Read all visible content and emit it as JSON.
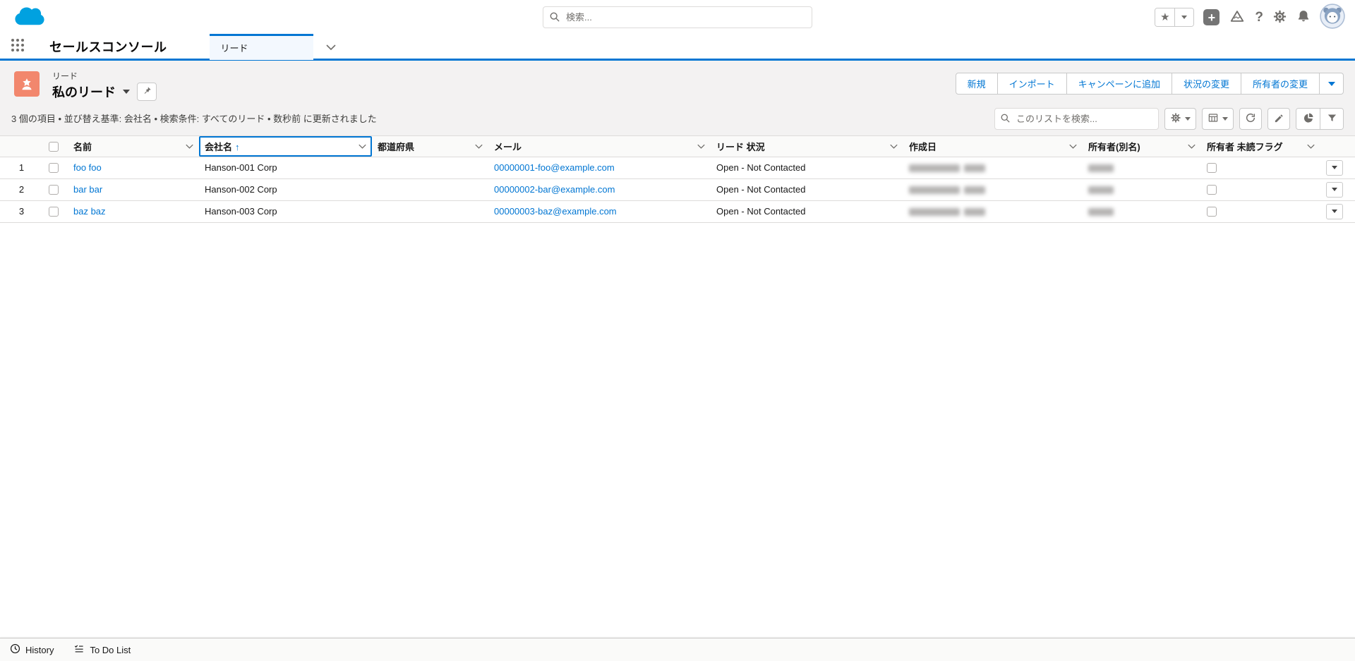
{
  "global_header": {
    "search_placeholder": "検索...",
    "icons": [
      "favorites-star",
      "favorites-caret",
      "global-actions-plus",
      "guidance-center",
      "help",
      "setup-gear",
      "notifications-bell",
      "user-avatar"
    ]
  },
  "nav": {
    "app_name": "セールスコンソール",
    "tab_label": "リード"
  },
  "page_header": {
    "object_label": "リード",
    "list_title": "私のリード",
    "actions": [
      {
        "label": "新規"
      },
      {
        "label": "インポート"
      },
      {
        "label": "キャンペーンに追加"
      },
      {
        "label": "状況の変更"
      },
      {
        "label": "所有者の変更"
      }
    ]
  },
  "list_meta": {
    "summary": "3 個の項目 • 並び替え基準: 会社名 • 検索条件: すべてのリード • 数秒前 に更新されました",
    "search_placeholder": "このリストを検索...",
    "controls": [
      "list-view-controls-gear",
      "display-as-table",
      "refresh",
      "inline-edit-pencil",
      "charts-pie",
      "filters-funnel"
    ]
  },
  "table": {
    "columns": [
      {
        "label": "名前"
      },
      {
        "label": "会社名",
        "sort": "↑",
        "sorted": true
      },
      {
        "label": "都道府県"
      },
      {
        "label": "メール"
      },
      {
        "label": "リード 状況"
      },
      {
        "label": "作成日",
        "redacted": true
      },
      {
        "label": "所有者(別名)",
        "redacted": true
      },
      {
        "label": "所有者 未読フラグ"
      }
    ],
    "rows": [
      {
        "num": "1",
        "name": "foo foo",
        "company": "Hanson-001 Corp",
        "state": "",
        "email": "00000001-foo@example.com",
        "status": "Open - Not Contacted"
      },
      {
        "num": "2",
        "name": "bar bar",
        "company": "Hanson-002 Corp",
        "state": "",
        "email": "00000002-bar@example.com",
        "status": "Open - Not Contacted"
      },
      {
        "num": "3",
        "name": "baz baz",
        "company": "Hanson-003 Corp",
        "state": "",
        "email": "00000003-baz@example.com",
        "status": "Open - Not Contacted"
      }
    ]
  },
  "utility_bar": {
    "items": [
      {
        "label": "History",
        "icon": "clock-icon"
      },
      {
        "label": "To Do List",
        "icon": "todo-list-icon"
      }
    ]
  },
  "colors": {
    "accent_blue": "#0176d3",
    "link_blue": "#0176d3",
    "lead_icon_orange": "#f2876d",
    "logo_blue": "#00a1e0",
    "header_gray_bg": "#f3f2f2"
  }
}
